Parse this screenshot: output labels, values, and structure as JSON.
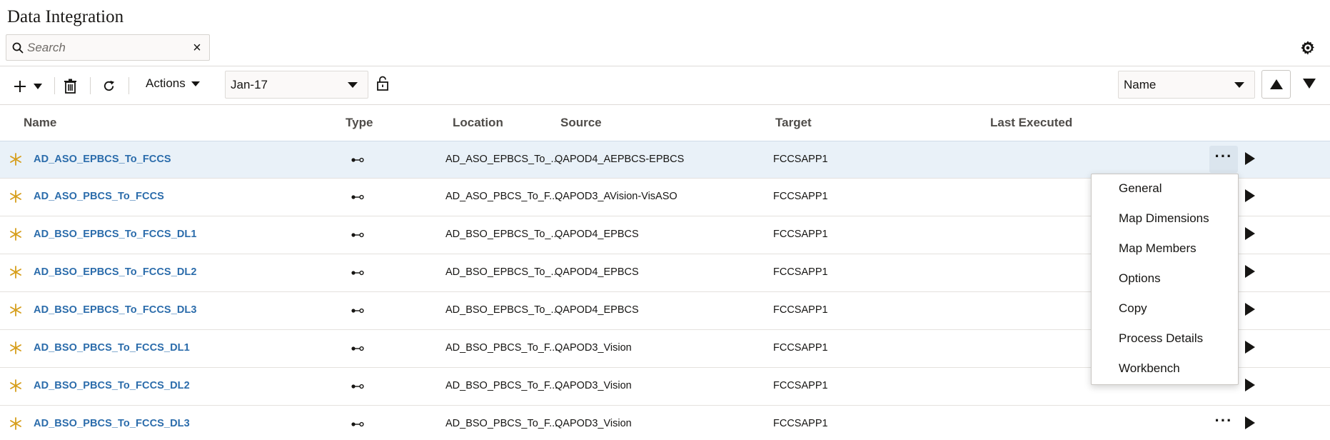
{
  "app": {
    "title": "Data Integration"
  },
  "search": {
    "placeholder": "Search",
    "value": "",
    "clear_glyph": "×"
  },
  "toolbar": {
    "add_icon": "plus-icon",
    "actions_label": "Actions",
    "period_value": "Jan-17",
    "sort_field": "Name"
  },
  "columns": {
    "name": "Name",
    "type": "Type",
    "location": "Location",
    "source": "Source",
    "target": "Target",
    "last_executed": "Last Executed"
  },
  "rows": [
    {
      "name": "AD_ASO_EPBCS_To_FCCS",
      "location": "AD_ASO_EPBCS_To_...",
      "source": "QAPOD4_AEPBCS-EPBCS",
      "target": "FCCSAPP1",
      "last_executed": ""
    },
    {
      "name": "AD_ASO_PBCS_To_FCCS",
      "location": "AD_ASO_PBCS_To_F...",
      "source": "QAPOD3_AVision-VisASO",
      "target": "FCCSAPP1",
      "last_executed": ""
    },
    {
      "name": "AD_BSO_EPBCS_To_FCCS_DL1",
      "location": "AD_BSO_EPBCS_To_...",
      "source": "QAPOD4_EPBCS",
      "target": "FCCSAPP1",
      "last_executed": ""
    },
    {
      "name": "AD_BSO_EPBCS_To_FCCS_DL2",
      "location": "AD_BSO_EPBCS_To_...",
      "source": "QAPOD4_EPBCS",
      "target": "FCCSAPP1",
      "last_executed": ""
    },
    {
      "name": "AD_BSO_EPBCS_To_FCCS_DL3",
      "location": "AD_BSO_EPBCS_To_...",
      "source": "QAPOD4_EPBCS",
      "target": "FCCSAPP1",
      "last_executed": ""
    },
    {
      "name": "AD_BSO_PBCS_To_FCCS_DL1",
      "location": "AD_BSO_PBCS_To_F...",
      "source": "QAPOD3_Vision",
      "target": "FCCSAPP1",
      "last_executed": ""
    },
    {
      "name": "AD_BSO_PBCS_To_FCCS_DL2",
      "location": "AD_BSO_PBCS_To_F...",
      "source": "QAPOD3_Vision",
      "target": "FCCSAPP1",
      "last_executed": ""
    },
    {
      "name": "AD_BSO_PBCS_To_FCCS_DL3",
      "location": "AD_BSO_PBCS_To_F...",
      "source": "QAPOD3_Vision",
      "target": "FCCSAPP1",
      "last_executed": ""
    }
  ],
  "row_actions": {
    "more_glyph": "···"
  },
  "context_menu": {
    "items": [
      "General",
      "Map Dimensions",
      "Map Members",
      "Options",
      "Copy",
      "Process Details",
      "Workbench"
    ]
  },
  "colors": {
    "link": "#2b6cab",
    "star": "#d69e1b",
    "selected_row": "#e9f1f8"
  }
}
